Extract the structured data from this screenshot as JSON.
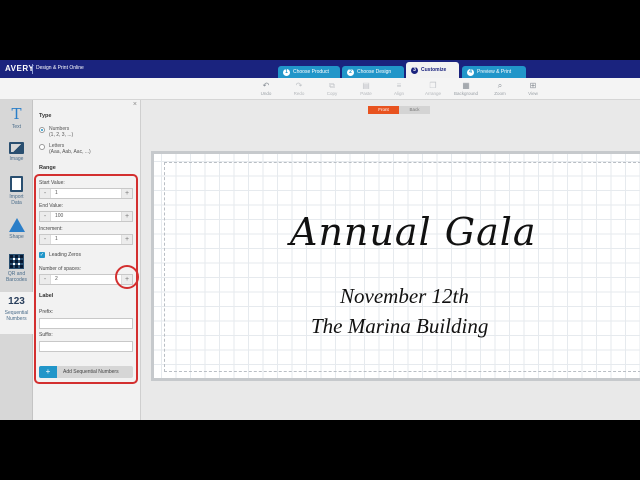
{
  "header": {
    "brand": "AVERY",
    "subtitle": "Design & Print Online",
    "steps": [
      {
        "num": "1",
        "label": "Choose Product"
      },
      {
        "num": "2",
        "label": "Choose Design"
      },
      {
        "num": "3",
        "label": "Customize"
      },
      {
        "num": "4",
        "label": "Preview & Print"
      }
    ]
  },
  "toolbar": {
    "undo": "Undo",
    "redo": "Redo",
    "copy": "Copy",
    "paste": "Paste",
    "align": "Align",
    "arrange": "Arrange",
    "background": "Background",
    "zoom": "Zoom",
    "view": "View"
  },
  "rail": {
    "text": "Text",
    "image": "Image",
    "import_data_1": "Import",
    "import_data_2": "Data",
    "shape": "Shape",
    "qr_1": "QR and",
    "qr_2": "Barcodes",
    "seq_icon": "123",
    "seq_1": "Sequential",
    "seq_2": "Numbers"
  },
  "panel": {
    "close": "×",
    "type_heading": "Type",
    "numbers_label": "Numbers",
    "numbers_hint": "(1, 2, 3, ...)",
    "letters_label": "Letters",
    "letters_hint": "(Aaa, Aab, Aac, ...)",
    "range_heading": "Range",
    "start_label": "Start Value:",
    "start_value": "1",
    "end_label": "End Value:",
    "end_value": "100",
    "inc_label": "Increment:",
    "inc_value": "1",
    "leading_zeros": "Leading Zeros",
    "spaces_label": "Number of spaces:",
    "spaces_value": "2",
    "label_heading": "Label",
    "prefix_label": "Prefix:",
    "suffix_label": "Suffix:",
    "add_button": "Add Sequential Numbers",
    "minus": "-",
    "plus": "+"
  },
  "canvas": {
    "front": "Front",
    "back": "Back",
    "title": "Annual Gala",
    "line1": "November 12th",
    "line2": "The Marina Building"
  },
  "colors": {
    "header_bg": "#1a237e",
    "step_bg": "#2196c9",
    "highlight": "#d32f2f",
    "front_active": "#e8531f"
  }
}
